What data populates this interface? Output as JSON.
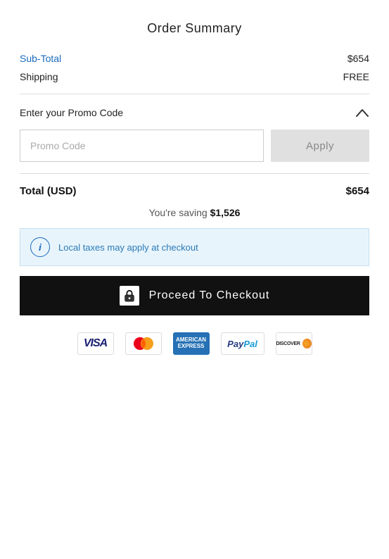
{
  "header": {
    "title": "Order Summary"
  },
  "line_items": {
    "subtotal_label": "Sub-Total",
    "subtotal_value": "$654",
    "shipping_label": "Shipping",
    "shipping_value": "FREE"
  },
  "promo": {
    "label": "Enter your Promo Code",
    "input_placeholder": "Promo Code",
    "apply_label": "Apply"
  },
  "total": {
    "label": "Total (USD)",
    "value": "$654"
  },
  "saving": {
    "prefix": "You're saving ",
    "amount": "$1,526"
  },
  "tax_notice": {
    "text": "Local taxes may apply at checkout"
  },
  "checkout": {
    "label": "Proceed To Checkout"
  },
  "payment_methods": [
    "VISA",
    "Mastercard",
    "Amex",
    "PayPal",
    "Discover"
  ]
}
